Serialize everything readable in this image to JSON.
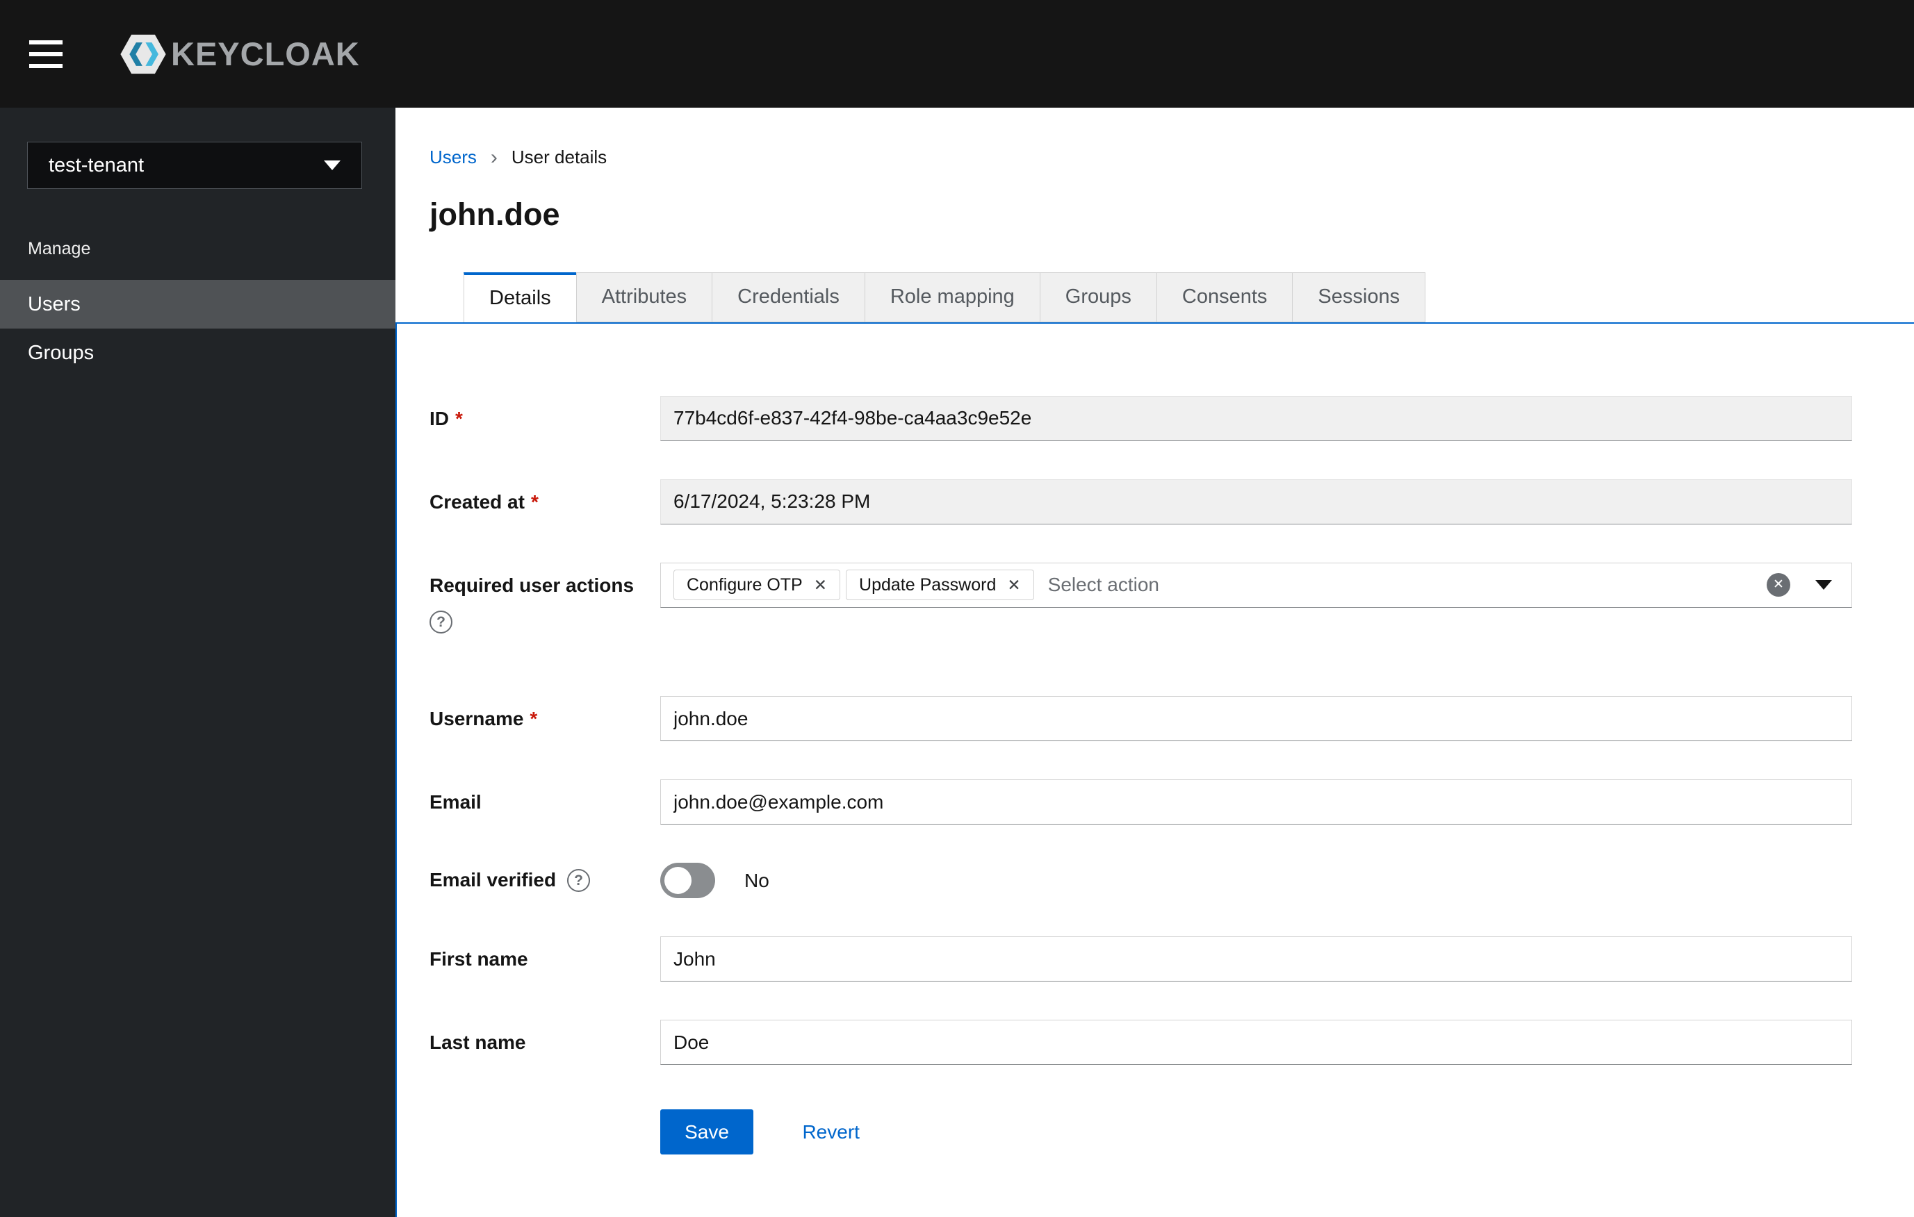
{
  "header": {
    "brand": "KEYCLOAK"
  },
  "sidebar": {
    "realm_selector": {
      "value": "test-tenant"
    },
    "section_label": "Manage",
    "items": [
      {
        "label": "Users",
        "active": true
      },
      {
        "label": "Groups",
        "active": false
      }
    ]
  },
  "breadcrumb": {
    "parent": "Users",
    "separator": "›",
    "current": "User details"
  },
  "page_title": "john.doe",
  "tabs": [
    {
      "label": "Details",
      "active": true
    },
    {
      "label": "Attributes",
      "active": false
    },
    {
      "label": "Credentials",
      "active": false
    },
    {
      "label": "Role mapping",
      "active": false
    },
    {
      "label": "Groups",
      "active": false
    },
    {
      "label": "Consents",
      "active": false
    },
    {
      "label": "Sessions",
      "active": false
    }
  ],
  "form": {
    "id": {
      "label": "ID",
      "required": "*",
      "value": "77b4cd6f-e837-42f4-98be-ca4aa3c9e52e"
    },
    "created_at": {
      "label": "Created at",
      "required": "*",
      "value": "6/17/2024, 5:23:28 PM"
    },
    "required_user_actions": {
      "label": "Required user actions",
      "chips": [
        "Configure OTP",
        "Update Password"
      ],
      "placeholder": "Select action"
    },
    "username": {
      "label": "Username",
      "required": "*",
      "value": "john.doe"
    },
    "email": {
      "label": "Email",
      "value": "john.doe@example.com"
    },
    "email_verified": {
      "label": "Email verified",
      "state": "No"
    },
    "first_name": {
      "label": "First name",
      "value": "John"
    },
    "last_name": {
      "label": "Last name",
      "value": "Doe"
    }
  },
  "actions": {
    "save": "Save",
    "revert": "Revert"
  },
  "icons": {
    "help_glyph": "?",
    "chip_remove_glyph": "✕",
    "clear_glyph": "✕"
  },
  "colors": {
    "accent": "#0066cc",
    "required": "#c9190b",
    "masthead": "#151515",
    "sidebar": "#212427",
    "nav_selected": "#4f5255"
  }
}
